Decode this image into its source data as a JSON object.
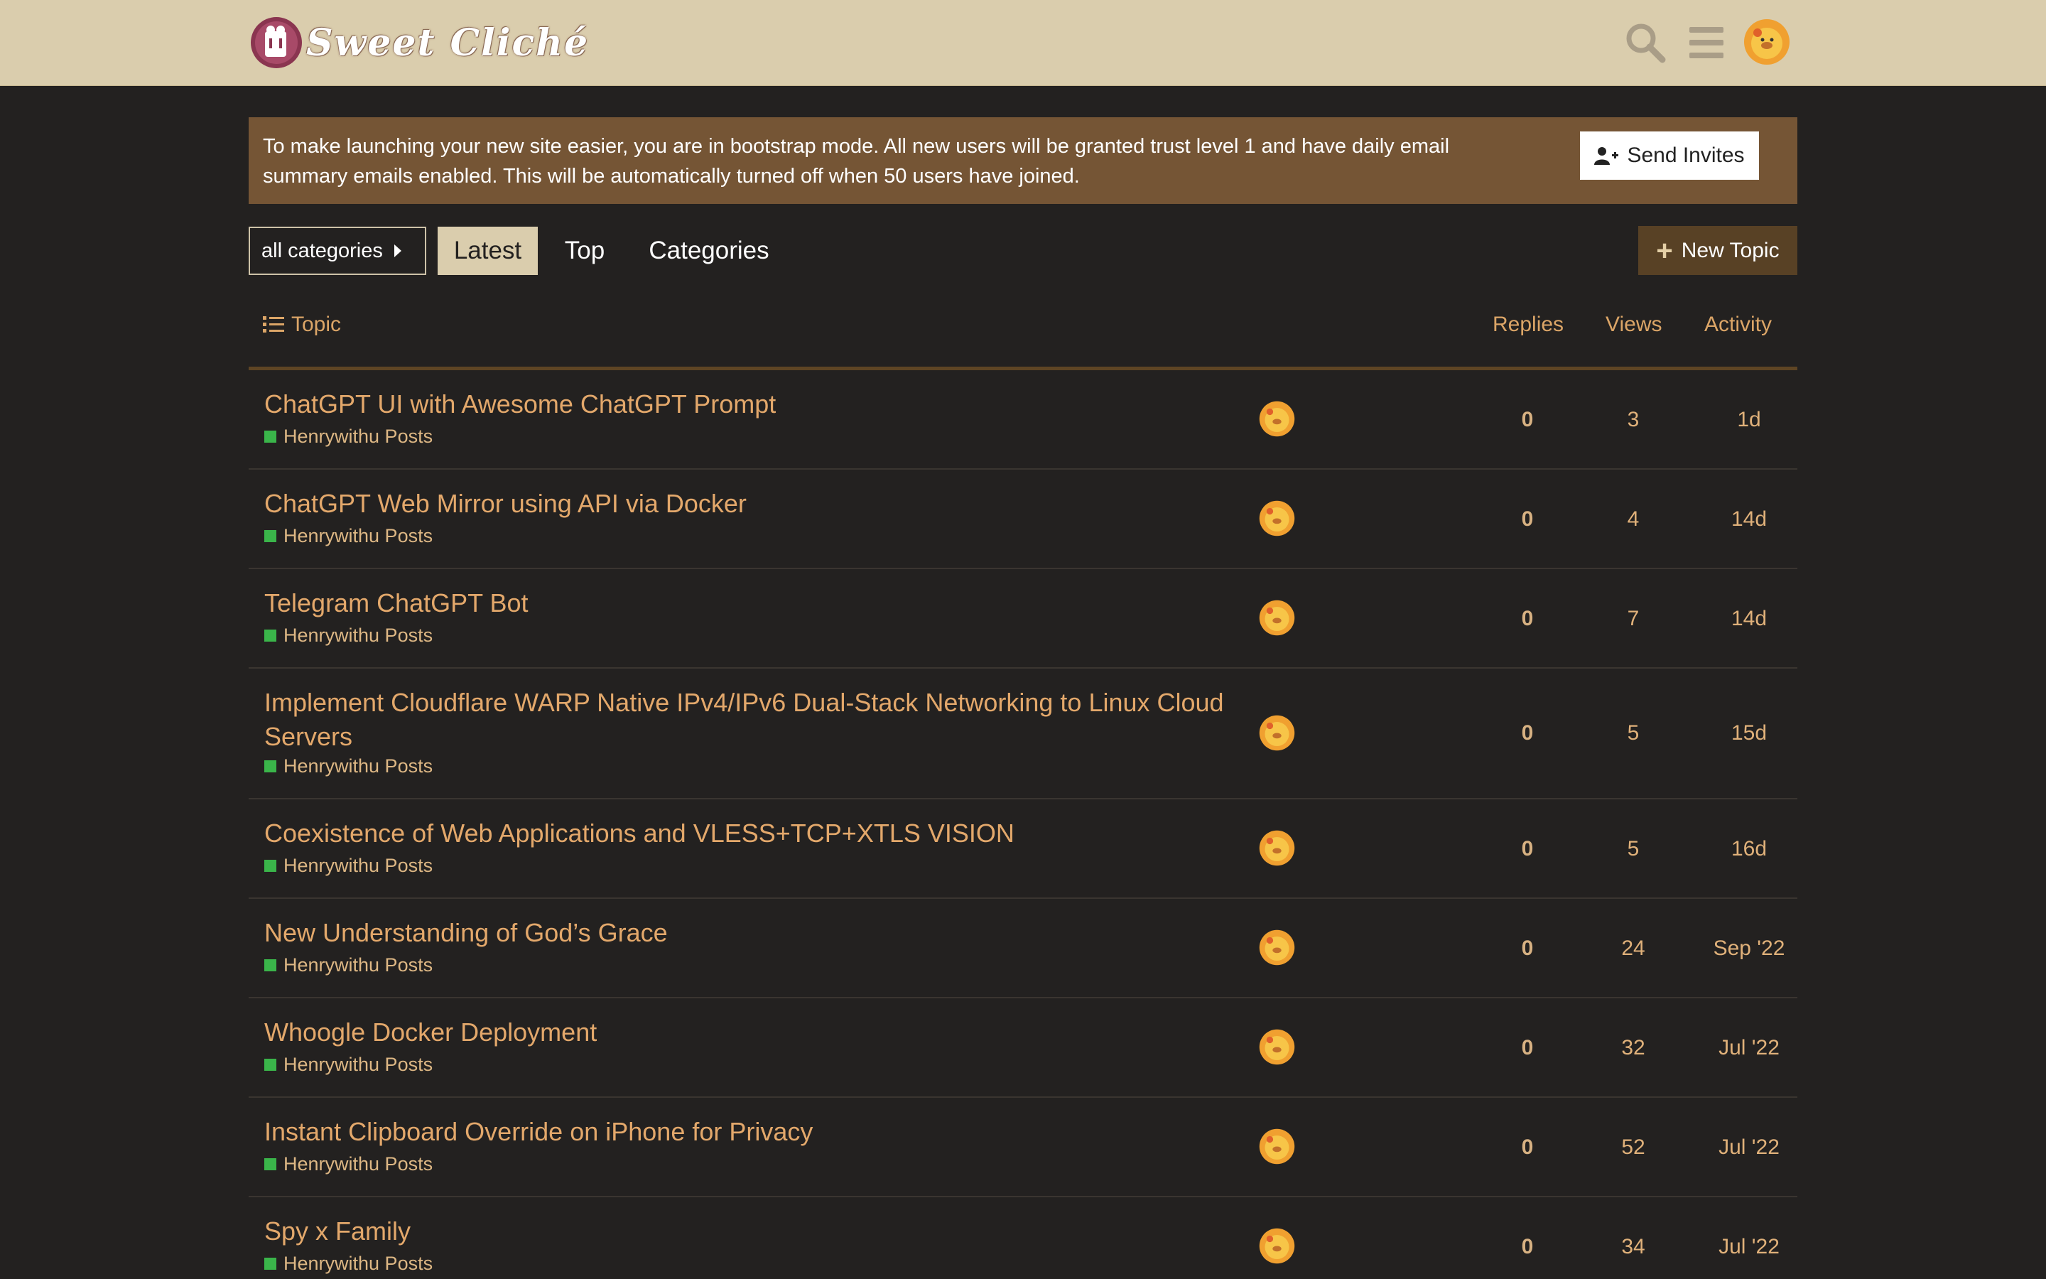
{
  "site": {
    "title": "Sweet Cliché"
  },
  "banner": {
    "line1": "To make launching your new site easier, you are in bootstrap mode. All new users will be granted trust level 1 and have daily email",
    "line2": "summary emails enabled. This will be automatically turned off when 50 users have joined.",
    "invite_label": "Send Invites"
  },
  "nav": {
    "categories_dropdown": "all categories",
    "tabs": [
      "Latest",
      "Top",
      "Categories"
    ],
    "active_tab": "Latest",
    "new_topic_label": "New Topic"
  },
  "table": {
    "headers": {
      "topic": "Topic",
      "replies": "Replies",
      "views": "Views",
      "activity": "Activity"
    },
    "rows": [
      {
        "title": "ChatGPT UI with Awesome ChatGPT Prompt",
        "category": "Henrywithu Posts",
        "replies": "0",
        "views": "3",
        "activity": "1d"
      },
      {
        "title": "ChatGPT Web Mirror using API via Docker",
        "category": "Henrywithu Posts",
        "replies": "0",
        "views": "4",
        "activity": "14d"
      },
      {
        "title": "Telegram ChatGPT Bot",
        "category": "Henrywithu Posts",
        "replies": "0",
        "views": "7",
        "activity": "14d"
      },
      {
        "title": "Implement Cloudflare WARP Native IPv4/IPv6 Dual-Stack Networking to Linux Cloud Servers",
        "category": "Henrywithu Posts",
        "replies": "0",
        "views": "5",
        "activity": "15d"
      },
      {
        "title": "Coexistence of Web Applications and VLESS+TCP+XTLS VISION",
        "category": "Henrywithu Posts",
        "replies": "0",
        "views": "5",
        "activity": "16d"
      },
      {
        "title": "New Understanding of God’s Grace",
        "category": "Henrywithu Posts",
        "replies": "0",
        "views": "24",
        "activity": "Sep '22"
      },
      {
        "title": "Whoogle Docker Deployment",
        "category": "Henrywithu Posts",
        "replies": "0",
        "views": "32",
        "activity": "Jul '22"
      },
      {
        "title": "Instant Clipboard Override on iPhone for Privacy",
        "category": "Henrywithu Posts",
        "replies": "0",
        "views": "52",
        "activity": "Jul '22"
      },
      {
        "title": "Spy x Family",
        "category": "Henrywithu Posts",
        "replies": "0",
        "views": "34",
        "activity": "Jul '22"
      }
    ]
  },
  "icons": {
    "logo": "site-logo-icon",
    "search": "search-icon",
    "menu": "hamburger-menu-icon",
    "avatar": "user-avatar-icon",
    "invite": "user-plus-icon",
    "new_topic": "plus-icon",
    "topic_list": "list-icon"
  },
  "colors": {
    "header_bg": "#dacdad",
    "page_bg": "#232120",
    "banner_bg": "#755535",
    "accent_link": "#e3a86b",
    "category_square": "#3ab54a",
    "new_topic_bg": "#584125"
  }
}
